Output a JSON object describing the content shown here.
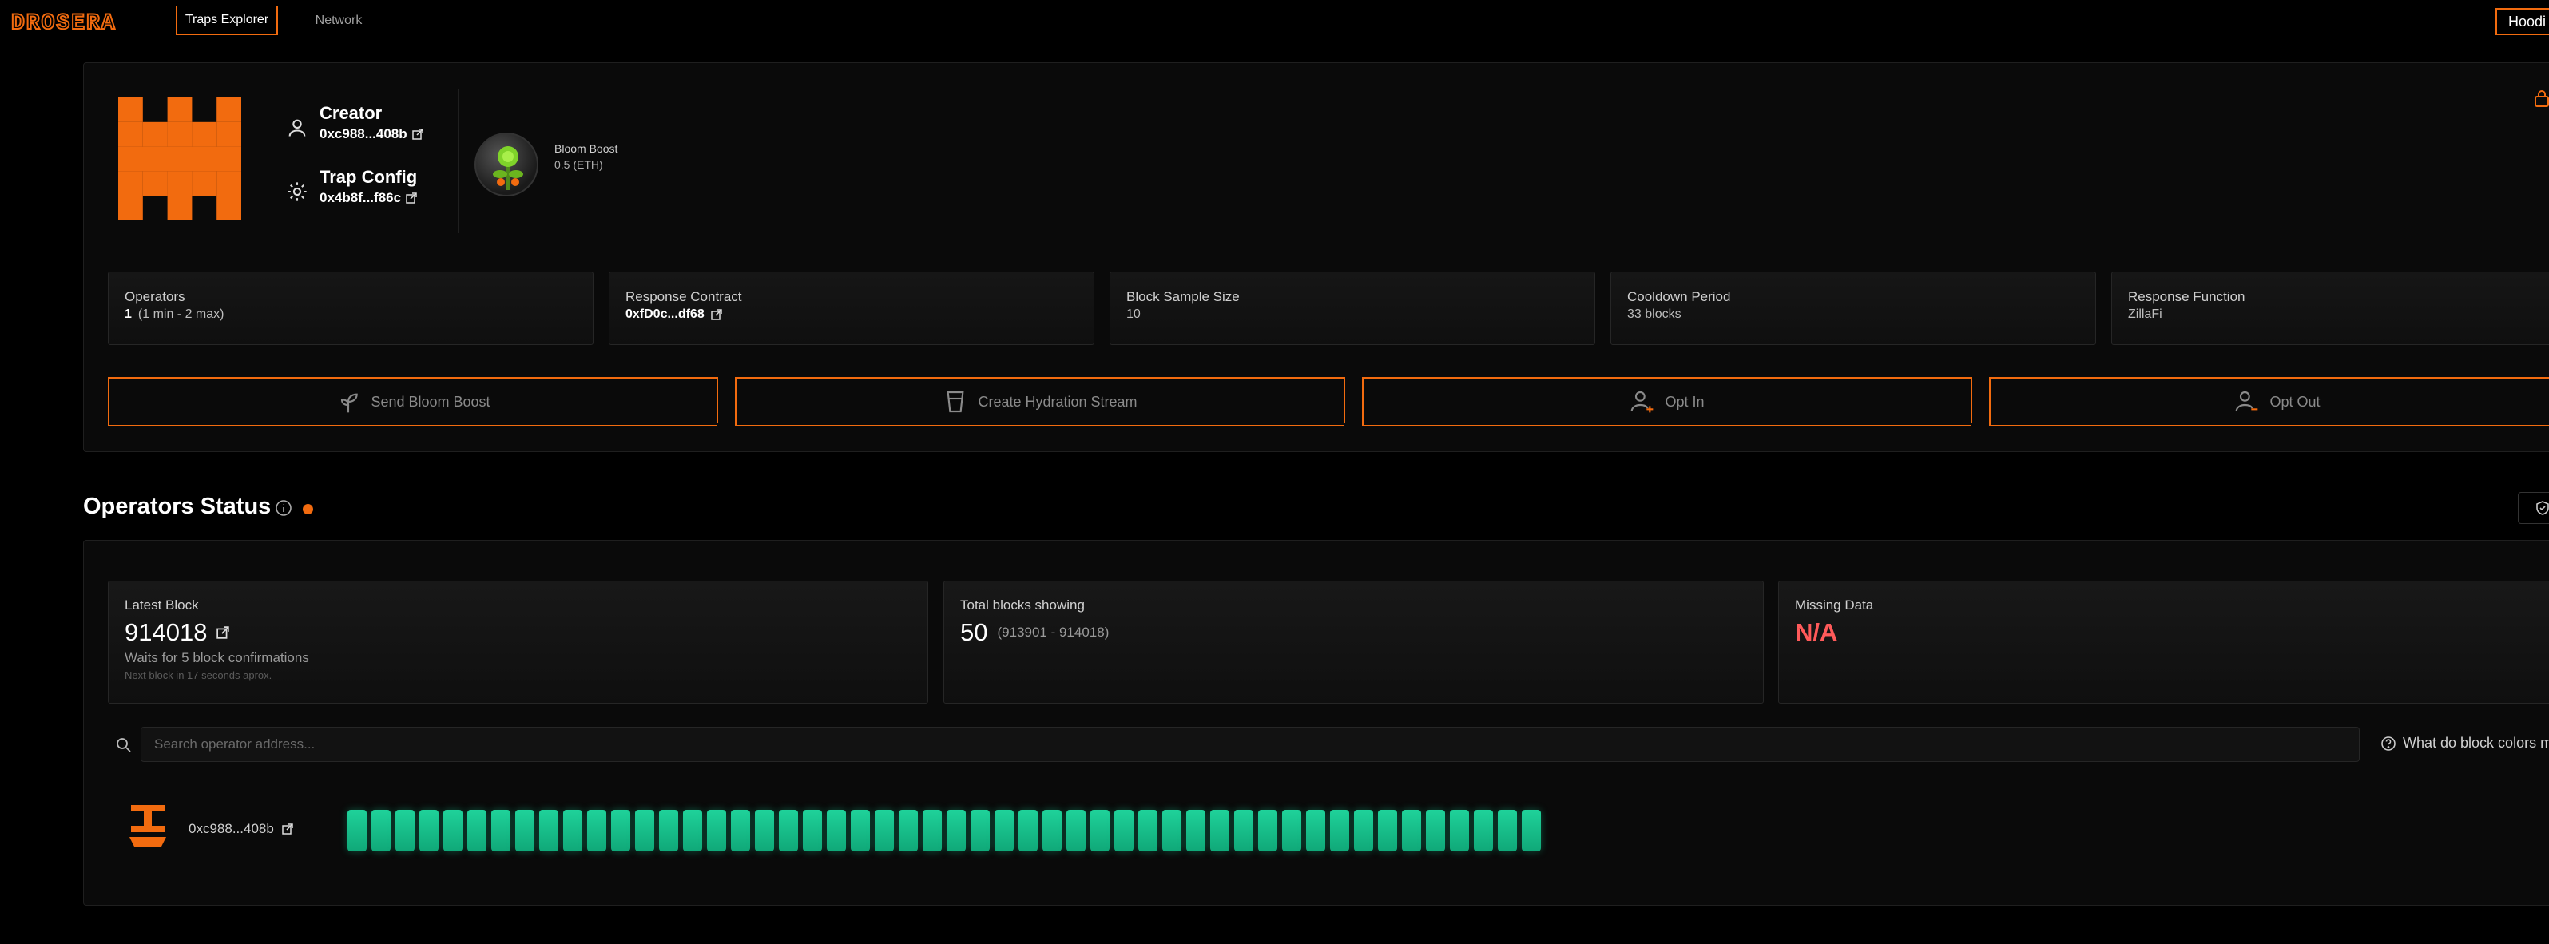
{
  "nav": {
    "logo_text": "DROSERA",
    "tabs": [
      {
        "label": "Traps Explorer",
        "active": true
      },
      {
        "label": "Network",
        "active": false
      }
    ],
    "network_selector": "Hoodi"
  },
  "trap": {
    "creator_label": "Creator",
    "creator_address": "0xc988...408b",
    "config_label": "Trap Config",
    "config_address": "0x4b8f...f86c",
    "bloom_boost_name": "Bloom Boost",
    "bloom_boost_amount": "0.5 (ETH)",
    "info_cards": [
      {
        "label": "Operators",
        "value_bold": "1",
        "value": "(1 min - 2 max)"
      },
      {
        "label": "Response Contract",
        "value_bold": "0xfD0c...df68",
        "value": ""
      },
      {
        "label": "Block Sample Size",
        "value_bold": "",
        "value": "10"
      },
      {
        "label": "Cooldown Period",
        "value_bold": "",
        "value": "33 blocks"
      },
      {
        "label": "Response Function",
        "value_bold": "",
        "value": "ZillaFi"
      }
    ],
    "actions": [
      {
        "label": "Send Bloom Boost",
        "icon": "sprout-icon"
      },
      {
        "label": "Create Hydration Stream",
        "icon": "glass-icon"
      },
      {
        "label": "Opt In",
        "icon": "user-plus-icon"
      },
      {
        "label": "Opt Out",
        "icon": "user-minus-icon"
      }
    ]
  },
  "operators_status": {
    "title": "Operators Status",
    "latest_block_label": "Latest Block",
    "latest_block": "914018",
    "confirmations": "Waits for 5 block confirmations",
    "next_block": "Next block in 17 seconds aprox.",
    "total_label": "Total blocks showing",
    "total_blocks": "50",
    "total_range": "(913901 - 914018)",
    "missing_label": "Missing Data",
    "missing_value": "N/A",
    "search_placeholder": "Search operator address...",
    "help_text": "What do block colors m",
    "operators": [
      {
        "address": "0xc988...408b",
        "blocks_shown": 50
      }
    ]
  },
  "colors": {
    "accent": "#f26b0f",
    "block_ok": "#18c98f",
    "missing": "#ff5a5a"
  }
}
